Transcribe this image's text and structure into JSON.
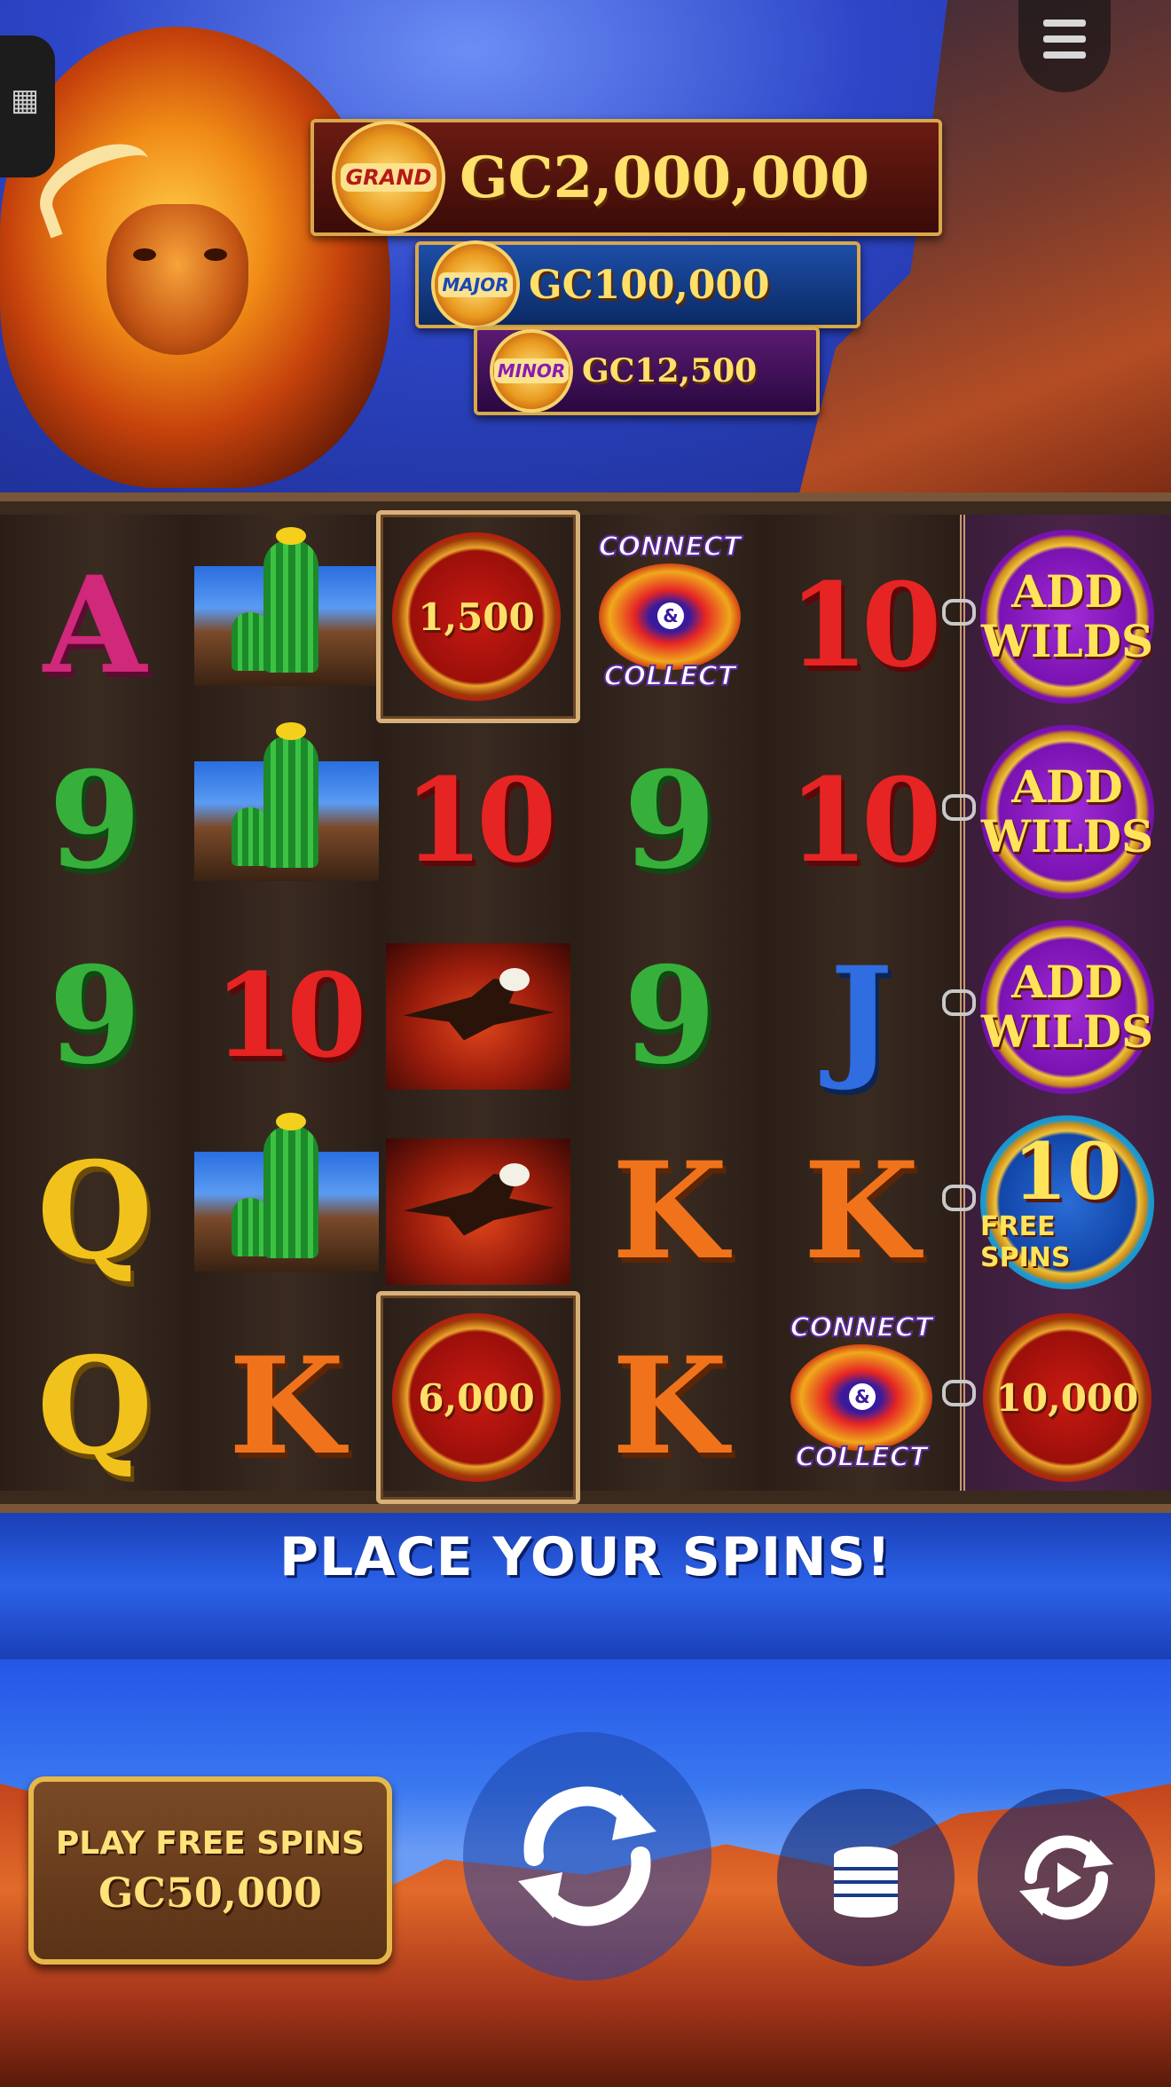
{
  "jackpots": {
    "grand": {
      "badge": "GRAND",
      "value": "GC2,000,000"
    },
    "major": {
      "badge": "MAJOR",
      "value": "GC100,000"
    },
    "minor": {
      "badge": "MINOR",
      "value": "GC12,500"
    }
  },
  "reels": {
    "reel1": [
      "A",
      "9",
      "9",
      "Q",
      "Q"
    ],
    "reel2": [
      "cactus",
      "cactus",
      "10",
      "cactus",
      "K"
    ],
    "reel3": [
      "1,500",
      "10",
      "eagle",
      "eagle",
      "6,000"
    ],
    "reel4": [
      "connect-collect",
      "9",
      "9",
      "K",
      "K"
    ],
    "reel5": [
      "10",
      "10",
      "J",
      "K",
      "connect-collect"
    ],
    "reel6": [
      "add-wilds",
      "add-wilds",
      "add-wilds",
      "free-spins",
      "10,000"
    ]
  },
  "symbols": {
    "sym_A": "A",
    "sym_9": "9",
    "sym_10": "10",
    "sym_Q": "Q",
    "sym_K": "K",
    "sym_J": "J",
    "coin_1500": "1,500",
    "coin_6000": "6,000",
    "coin_10000": "10,000",
    "connect": "CONNECT",
    "amp": "&",
    "collect": "COLLECT",
    "add": "ADD",
    "wilds": "WILDS",
    "free_spins_num": "10",
    "free_spins_lbl": "FREE SPINS"
  },
  "status": {
    "message": "PLACE YOUR SPINS!"
  },
  "controls": {
    "play_free_spins_label": "PLAY FREE SPINS",
    "play_free_spins_cost": "GC50,000",
    "spin_icon": "spin-icon",
    "coins_icon": "coin-stack-icon",
    "autoplay_icon": "autoplay-icon"
  },
  "colors": {
    "accent_gold": "#ffe06a",
    "status_blue": "#2b62e8",
    "reel_purple": "#4a2448"
  }
}
